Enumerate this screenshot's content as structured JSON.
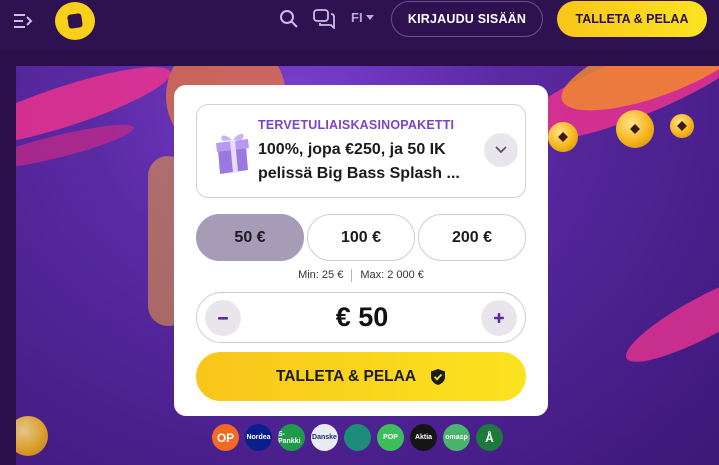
{
  "header": {
    "language": "FI",
    "login_label": "KIRJAUDU SISÄÄN",
    "cta_label": "TALLETA & PELAA"
  },
  "bonus": {
    "label": "TERVETULIAISKASINOPAKETTI",
    "title": "100%, jopa €250, ja 50 IK pelissä Big Bass Splash ..."
  },
  "amount_options": [
    "50 €",
    "100 €",
    "200 €"
  ],
  "selected_amount": "50 €",
  "limits": {
    "min": "Min: 25 €",
    "max": "Max: 2 000 €"
  },
  "stepper": {
    "value": "€ 50",
    "minus": "−",
    "plus": "+"
  },
  "cta": {
    "label": "TALLETA & PELAA"
  },
  "payment_methods": [
    {
      "name": "OP",
      "label": "OP",
      "color": "#f26a21"
    },
    {
      "name": "Nordea",
      "label": "Nordea",
      "color": "#0a1e8c"
    },
    {
      "name": "S-Pankki",
      "label": "S-Pankki",
      "color": "#1f9a4a"
    },
    {
      "name": "Danske Bank",
      "label": "Danske",
      "color": "#e8ecf2"
    },
    {
      "name": "Säästöpankki",
      "label": "",
      "color": "#1d8c7a"
    },
    {
      "name": "POP Pankki",
      "label": "POP",
      "color": "#3cbf5a"
    },
    {
      "name": "Aktia",
      "label": "Aktia",
      "color": "#151515"
    },
    {
      "name": "Oma Säästöpankki",
      "label": "omasp",
      "color": "#49b56a"
    },
    {
      "name": "Ålandsbanken",
      "label": "Å",
      "color": "#1e7a3c"
    }
  ],
  "colors": {
    "header_bg": "#2d1150",
    "accent_yellow": "#fbe320",
    "accent_purple": "#7a43c9",
    "selected_amount_bg": "#a79cb7"
  }
}
